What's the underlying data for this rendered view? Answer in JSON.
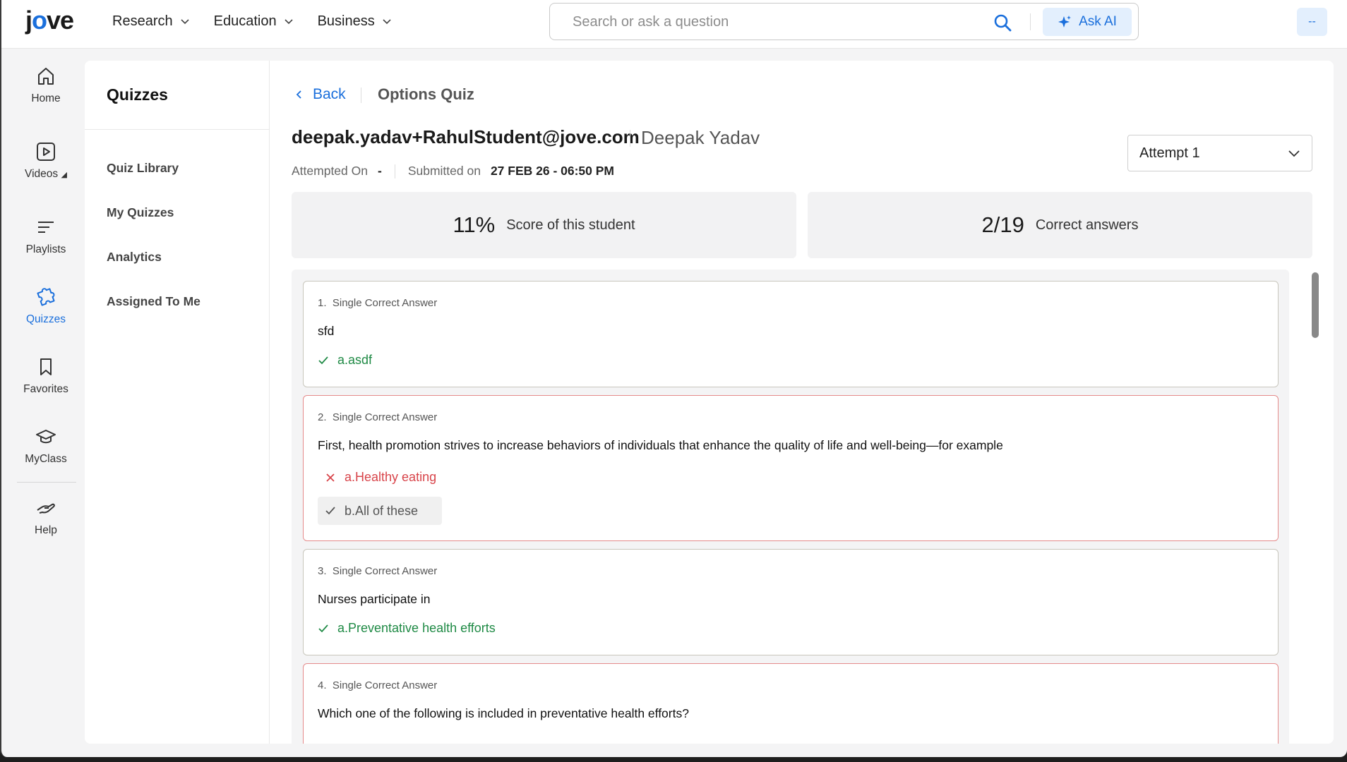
{
  "header": {
    "logo": {
      "pre": "j",
      "o": "o",
      "post": "ve"
    },
    "nav": [
      {
        "label": "Research"
      },
      {
        "label": "Education"
      },
      {
        "label": "Business"
      }
    ],
    "search": {
      "placeholder": "Search or ask a question",
      "value": ""
    },
    "ask_ai_label": "Ask AI",
    "avatar_label": "--"
  },
  "rail": [
    {
      "label": "Home",
      "icon": "home-icon"
    },
    {
      "label": "Videos",
      "icon": "video-icon",
      "caret": "◢"
    },
    {
      "label": "Playlists",
      "icon": "playlist-icon"
    },
    {
      "label": "Quizzes",
      "icon": "puzzle-icon",
      "active": true
    },
    {
      "label": "Favorites",
      "icon": "bookmark-icon"
    },
    {
      "label": "MyClass",
      "icon": "graduation-cap-icon"
    },
    {
      "label": "Help",
      "icon": "help-hand-icon"
    }
  ],
  "sidebar": {
    "title": "Quizzes",
    "links": [
      "Quiz Library",
      "My Quizzes",
      "Analytics",
      "Assigned To Me"
    ]
  },
  "breadcrumb": {
    "back_label": "Back",
    "title": "Options Quiz"
  },
  "student": {
    "email": "deepak.yadav+RahulStudent@jove.com",
    "name": "Deepak Yadav",
    "attempted_on_label": "Attempted On",
    "attempted_on_value": "-",
    "submitted_on_label": "Submitted on",
    "submitted_on_value": "27 FEB 26 - 06:50 PM"
  },
  "attempt_select": {
    "value": "Attempt 1"
  },
  "summary": {
    "score_value": "11%",
    "score_label": "Score of this student",
    "correct_value": "2/19",
    "correct_label": "Correct answers"
  },
  "questions": [
    {
      "number": "1.",
      "type": "Single Correct Answer",
      "text": "sfd",
      "options": [
        {
          "label": "a.asdf",
          "state": "correct"
        }
      ]
    },
    {
      "number": "2.",
      "type": "Single Correct Answer",
      "text": "First, health promotion strives to increase behaviors of individuals that enhance the quality of life and well-being—for example",
      "options": [
        {
          "label": "a.Healthy eating",
          "state": "incorrect"
        },
        {
          "label": "b.All of these",
          "state": "key"
        }
      ]
    },
    {
      "number": "3.",
      "type": "Single Correct Answer",
      "text": "Nurses participate in",
      "options": [
        {
          "label": "a.Preventative health efforts",
          "state": "correct"
        }
      ]
    },
    {
      "number": "4.",
      "type": "Single Correct Answer",
      "text": "Which one of the following is included in preventative health efforts?",
      "options": []
    }
  ],
  "colors": {
    "accent": "#1a6fdc",
    "correct": "#1f8a45",
    "incorrect": "#d8444a",
    "wrong_border": "#e58b8b"
  }
}
